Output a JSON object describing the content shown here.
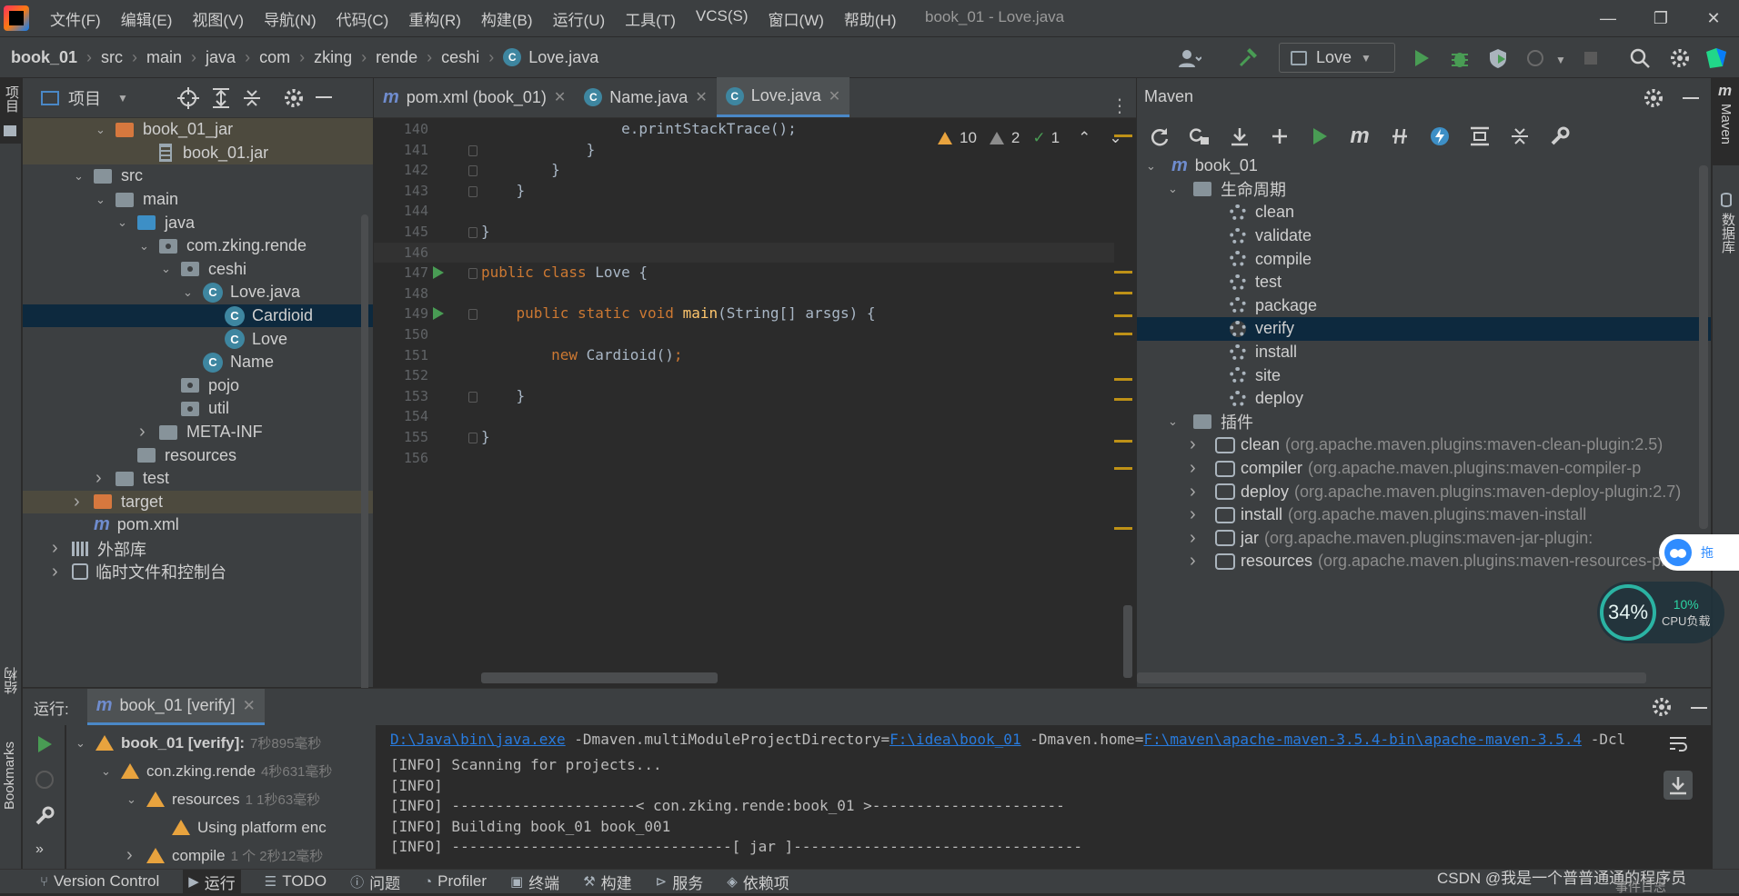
{
  "window": {
    "title": "book_01 - Love.java"
  },
  "menu": [
    "文件(F)",
    "编辑(E)",
    "视图(V)",
    "导航(N)",
    "代码(C)",
    "重构(R)",
    "构建(B)",
    "运行(U)",
    "工具(T)",
    "VCS(S)",
    "窗口(W)",
    "帮助(H)"
  ],
  "breadcrumbs": [
    "book_01",
    "src",
    "main",
    "java",
    "com",
    "zking",
    "rende",
    "ceshi",
    "Love.java"
  ],
  "run_config": "Love",
  "project": {
    "title": "项目",
    "tree": [
      {
        "label": "book_01_jar",
        "icon": "folder-orange",
        "depth": 3,
        "open": true,
        "style": "highlight"
      },
      {
        "label": "book_01.jar",
        "icon": "jar",
        "depth": 5,
        "style": "highlight"
      },
      {
        "label": "src",
        "icon": "folder",
        "depth": 2,
        "open": true
      },
      {
        "label": "main",
        "icon": "folder",
        "depth": 3,
        "open": true
      },
      {
        "label": "java",
        "icon": "folder-blue",
        "depth": 4,
        "open": true
      },
      {
        "label": "com.zking.rende",
        "icon": "package",
        "depth": 5,
        "open": true
      },
      {
        "label": "ceshi",
        "icon": "package",
        "depth": 6,
        "open": true
      },
      {
        "label": "Love.java",
        "icon": "class-file",
        "depth": 7,
        "open": true
      },
      {
        "label": "Cardioid",
        "icon": "class",
        "depth": 8,
        "style": "selected"
      },
      {
        "label": "Love",
        "icon": "class",
        "depth": 8
      },
      {
        "label": "Name",
        "icon": "class",
        "depth": 7
      },
      {
        "label": "pojo",
        "icon": "package",
        "depth": 6
      },
      {
        "label": "util",
        "icon": "package",
        "depth": 6
      },
      {
        "label": "META-INF",
        "icon": "folder",
        "depth": 5,
        "open": false
      },
      {
        "label": "resources",
        "icon": "folder-res",
        "depth": 4
      },
      {
        "label": "test",
        "icon": "folder",
        "depth": 3,
        "open": false
      },
      {
        "label": "target",
        "icon": "folder-orange",
        "depth": 2,
        "open": false,
        "style": "highlight"
      },
      {
        "label": "pom.xml",
        "icon": "maven",
        "depth": 2
      },
      {
        "label": "外部库",
        "icon": "library",
        "depth": 1,
        "open": false
      },
      {
        "label": "临时文件和控制台",
        "icon": "scratch",
        "depth": 1,
        "open": false
      }
    ]
  },
  "editor": {
    "tabs": [
      {
        "label": "pom.xml (book_01)",
        "icon": "m",
        "active": false
      },
      {
        "label": "Name.java",
        "icon": "c",
        "active": false
      },
      {
        "label": "Love.java",
        "icon": "c",
        "active": true
      }
    ],
    "inspections": {
      "warnings": "10",
      "weak": "2",
      "ok": "1"
    },
    "lines": [
      {
        "n": "140",
        "code": [
          {
            "t": "                e.printStackTrace();"
          }
        ]
      },
      {
        "n": "141",
        "code": [
          {
            "t": "            }"
          }
        ]
      },
      {
        "n": "142",
        "code": [
          {
            "t": "        }"
          }
        ]
      },
      {
        "n": "143",
        "code": [
          {
            "t": "    }"
          }
        ]
      },
      {
        "n": "144",
        "code": [
          {
            "t": ""
          }
        ]
      },
      {
        "n": "145",
        "code": [
          {
            "t": "}"
          }
        ]
      },
      {
        "n": "146",
        "code": [
          {
            "t": ""
          }
        ],
        "current": true
      },
      {
        "n": "147",
        "code": [
          {
            "t": "public class ",
            "c": "kw"
          },
          {
            "t": "Love {"
          }
        ],
        "run": true
      },
      {
        "n": "148",
        "code": [
          {
            "t": ""
          }
        ]
      },
      {
        "n": "149",
        "code": [
          {
            "t": "    "
          },
          {
            "t": "public static void ",
            "c": "kw"
          },
          {
            "t": "main",
            "c": "fn"
          },
          {
            "t": "(String[] arsgs) {"
          }
        ],
        "run": true
      },
      {
        "n": "150",
        "code": [
          {
            "t": ""
          }
        ]
      },
      {
        "n": "151",
        "code": [
          {
            "t": "        "
          },
          {
            "t": "new ",
            "c": "kw"
          },
          {
            "t": "Cardioid()"
          },
          {
            "t": ";",
            "c": "kw"
          }
        ]
      },
      {
        "n": "152",
        "code": [
          {
            "t": ""
          }
        ]
      },
      {
        "n": "153",
        "code": [
          {
            "t": "    }"
          }
        ]
      },
      {
        "n": "154",
        "code": [
          {
            "t": ""
          }
        ]
      },
      {
        "n": "155",
        "code": [
          {
            "t": "}"
          }
        ]
      },
      {
        "n": "156",
        "code": [
          {
            "t": ""
          }
        ]
      }
    ]
  },
  "maven": {
    "title": "Maven",
    "rows": [
      {
        "label": "book_01",
        "type": "project",
        "depth": 0,
        "open": true
      },
      {
        "label": "生命周期",
        "type": "lifecycle",
        "depth": 1,
        "open": true
      },
      {
        "label": "clean",
        "type": "goal",
        "depth": 2
      },
      {
        "label": "validate",
        "type": "goal",
        "depth": 2
      },
      {
        "label": "compile",
        "type": "goal",
        "depth": 2
      },
      {
        "label": "test",
        "type": "goal",
        "depth": 2
      },
      {
        "label": "package",
        "type": "goal",
        "depth": 2
      },
      {
        "label": "verify",
        "type": "goal",
        "depth": 2,
        "selected": true
      },
      {
        "label": "install",
        "type": "goal",
        "depth": 2
      },
      {
        "label": "site",
        "type": "goal",
        "depth": 2
      },
      {
        "label": "deploy",
        "type": "goal",
        "depth": 2
      },
      {
        "label": "插件",
        "type": "plugins",
        "depth": 1,
        "open": true
      },
      {
        "label": "clean",
        "detail": "(org.apache.maven.plugins:maven-clean-plugin:2.5)",
        "type": "plugin",
        "depth": 2
      },
      {
        "label": "compiler",
        "detail": "(org.apache.maven.plugins:maven-compiler-p",
        "type": "plugin",
        "depth": 2
      },
      {
        "label": "deploy",
        "detail": "(org.apache.maven.plugins:maven-deploy-plugin:2.7)",
        "type": "plugin",
        "depth": 2
      },
      {
        "label": "install",
        "detail": "(org.apache.maven.plugins:maven-install",
        "type": "plugin",
        "depth": 2
      },
      {
        "label": "jar",
        "detail": "(org.apache.maven.plugins:maven-jar-plugin:",
        "type": "plugin",
        "depth": 2
      },
      {
        "label": "resources",
        "detail": "(org.apache.maven.plugins:maven-resources-plugin:",
        "type": "plugin",
        "depth": 2
      }
    ]
  },
  "side": {
    "left_top": "项目",
    "left_structure": "结构",
    "left_bookmarks": "Bookmarks",
    "right_maven": "Maven",
    "right_db": "数据库"
  },
  "cpu_widget": {
    "percent": "34%",
    "load": "10%",
    "label": "CPU负载"
  },
  "baidu_btn": "拖",
  "run": {
    "label": "运行:",
    "tab": "book_01 [verify]",
    "tree": [
      {
        "label": "book_01 [verify]:",
        "time": "7秒895毫秒",
        "depth": 0,
        "bold": true
      },
      {
        "label": "con.zking.rende",
        "time": "4秒631毫秒",
        "depth": 1
      },
      {
        "label": "resources",
        "time": "1  1秒63毫秒",
        "depth": 2
      },
      {
        "label": "Using platform enc",
        "time": "",
        "depth": 3
      },
      {
        "label": "compile",
        "time": "1 个 2秒12毫秒",
        "depth": 2
      }
    ],
    "console": {
      "line0_java": "D:\\Java\\bin\\java.exe",
      "line0_a": " -Dmaven.multiModuleProjectDirectory=",
      "line0_dir": "F:\\idea\\book_01",
      "line0_b": " -Dmaven.home=",
      "line0_home": "F:\\maven\\apache-maven-3.5.4-bin\\apache-maven-3.5.4",
      "line0_c": " -Dcl",
      "lines": [
        "[INFO] Scanning for projects...",
        "[INFO]",
        "[INFO] ---------------------< con.zking.rende:book_01 >----------------------",
        "[INFO] Building book_01 book_001",
        "[INFO] --------------------------------[ jar ]---------------------------------"
      ]
    }
  },
  "statusbar": [
    "Version Control",
    "运行",
    "TODO",
    "问题",
    "Profiler",
    "终端",
    "构建",
    "服务",
    "依赖项"
  ],
  "watermark": "CSDN @我是一个普普通通的程序员",
  "event_log": "事件日志"
}
